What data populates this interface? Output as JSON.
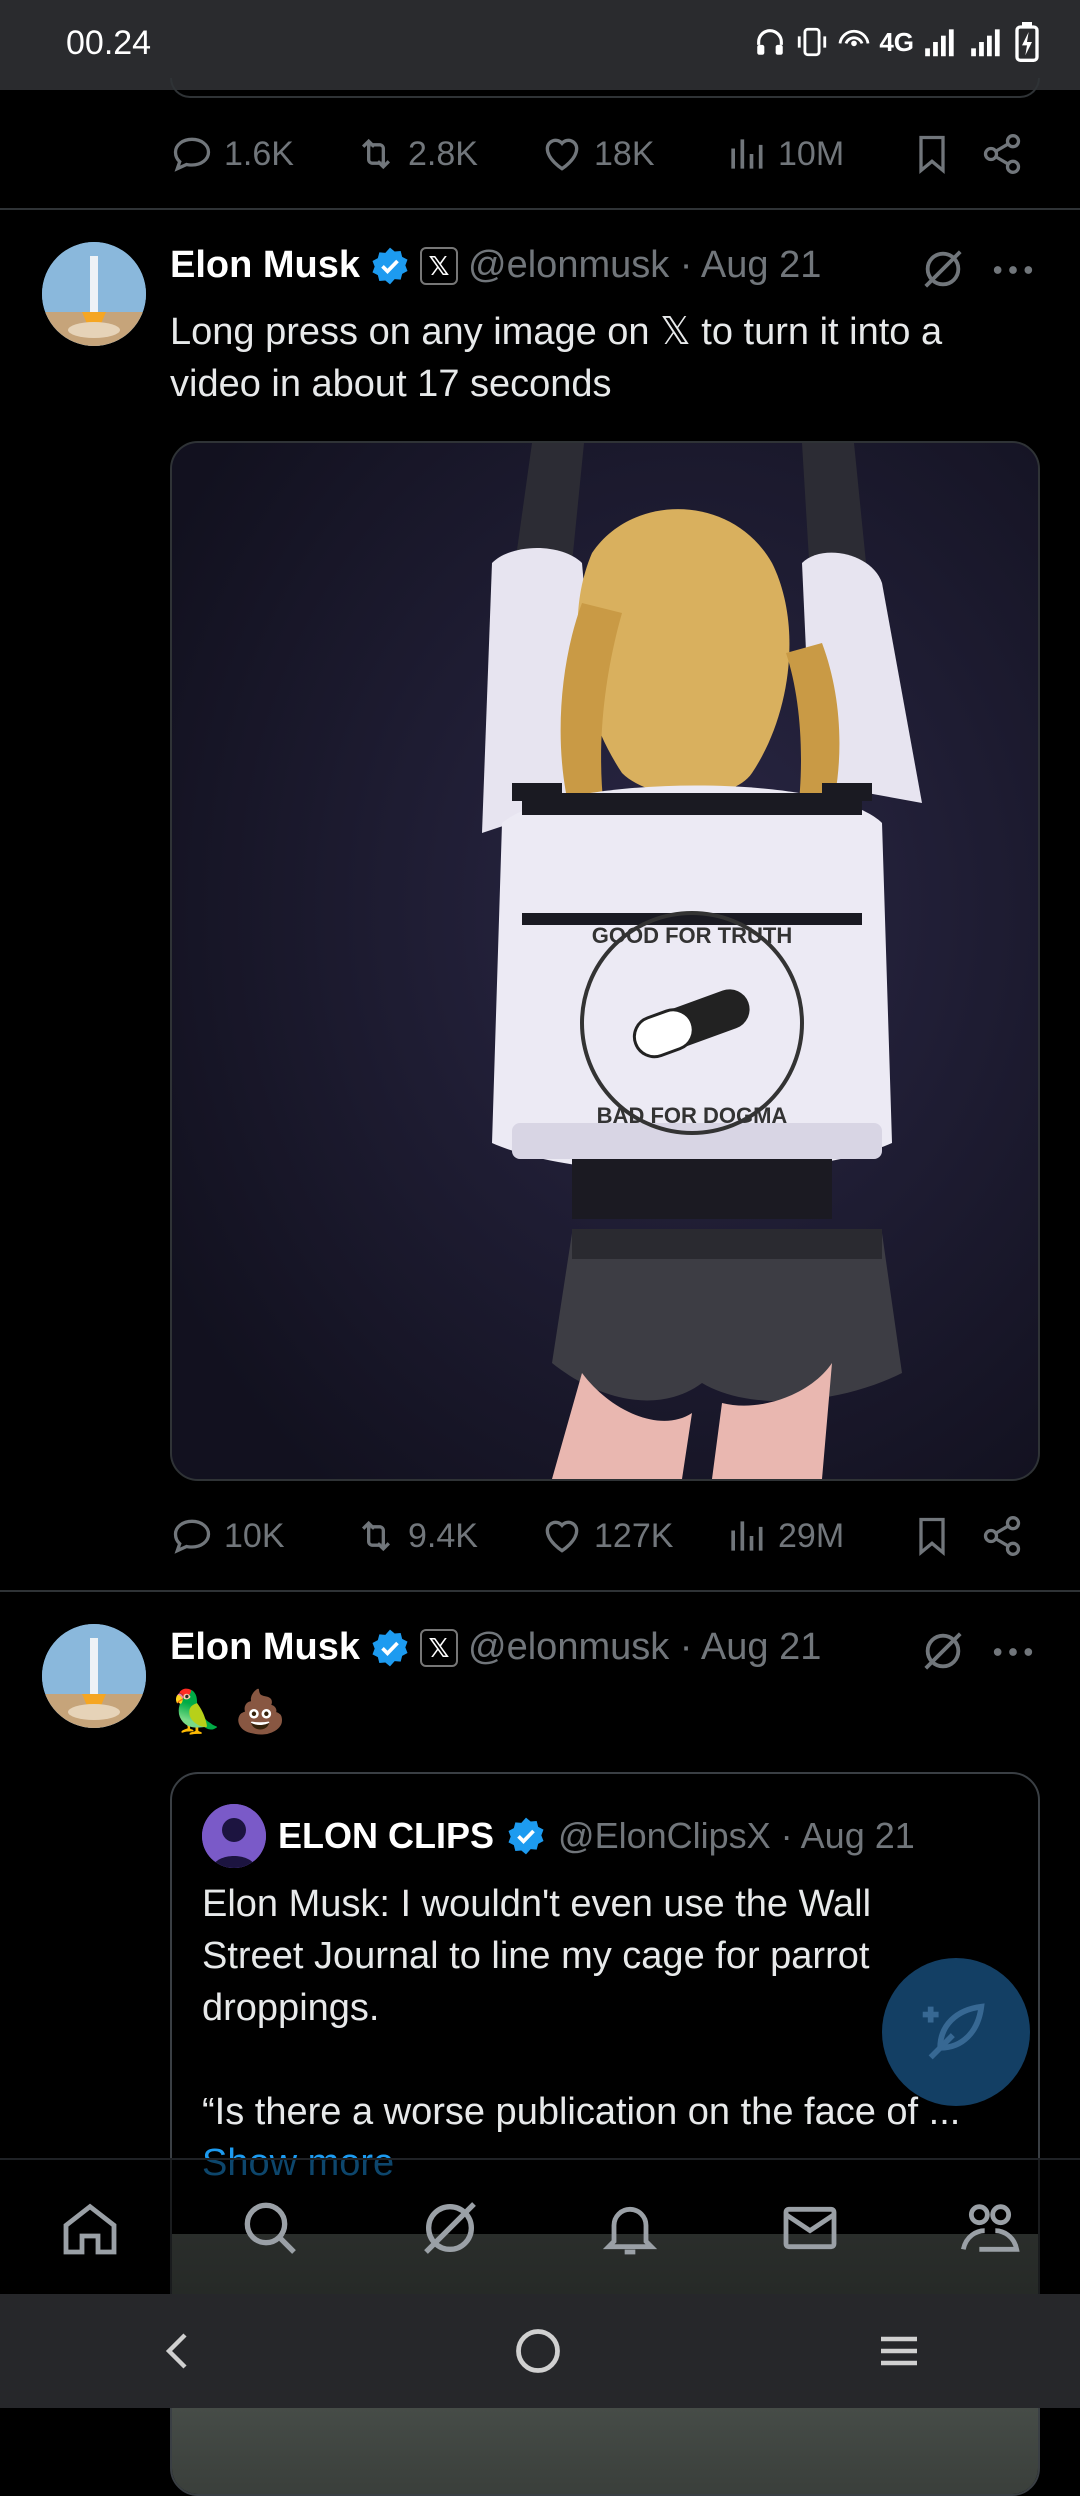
{
  "status_bar": {
    "time": "00.24",
    "network": "4G"
  },
  "tweet0_actions": {
    "replies": "1.6K",
    "reposts": "2.8K",
    "likes": "18K",
    "views": "10M"
  },
  "tweet1": {
    "author": "Elon Musk",
    "x_badge": "𝕏",
    "handle_date": "@elonmusk · Aug 21",
    "text_line1": "Long press on any image on 𝕏 to turn it into a",
    "text_line2": "video in about 17 seconds",
    "image_text_top": "GOOD FOR TRUTH",
    "image_text_bottom": "BAD FOR DOGMA",
    "actions": {
      "replies": "10K",
      "reposts": "9.4K",
      "likes": "127K",
      "views": "29M"
    }
  },
  "tweet2": {
    "author": "Elon Musk",
    "x_badge": "𝕏",
    "handle_date": "@elonmusk · Aug 21",
    "emojis": "🦜 💩",
    "quote": {
      "author": "ELON CLIPS",
      "handle_date": "@ElonClipsX · Aug 21",
      "line1": "Elon Musk: I wouldn't even use the Wall",
      "line2": "Street Journal to line my cage for parrot",
      "line3": "droppings.",
      "line4": "“Is there a worse publication on the face of ...",
      "show_more": "Show more"
    }
  },
  "icons": {
    "reply": "reply-icon",
    "repost": "repost-icon",
    "like": "like-icon",
    "views": "views-icon",
    "bookmark": "bookmark-icon",
    "share": "share-icon",
    "grok": "grok-icon",
    "more": "more-icon",
    "home": "home-icon",
    "search": "search-icon",
    "notifications": "bell-icon",
    "messages": "mail-icon",
    "communities": "communities-icon"
  },
  "colors": {
    "accent": "#1d9bf0",
    "muted": "#71767b",
    "background": "#000000",
    "text": "#e7e9ea"
  }
}
